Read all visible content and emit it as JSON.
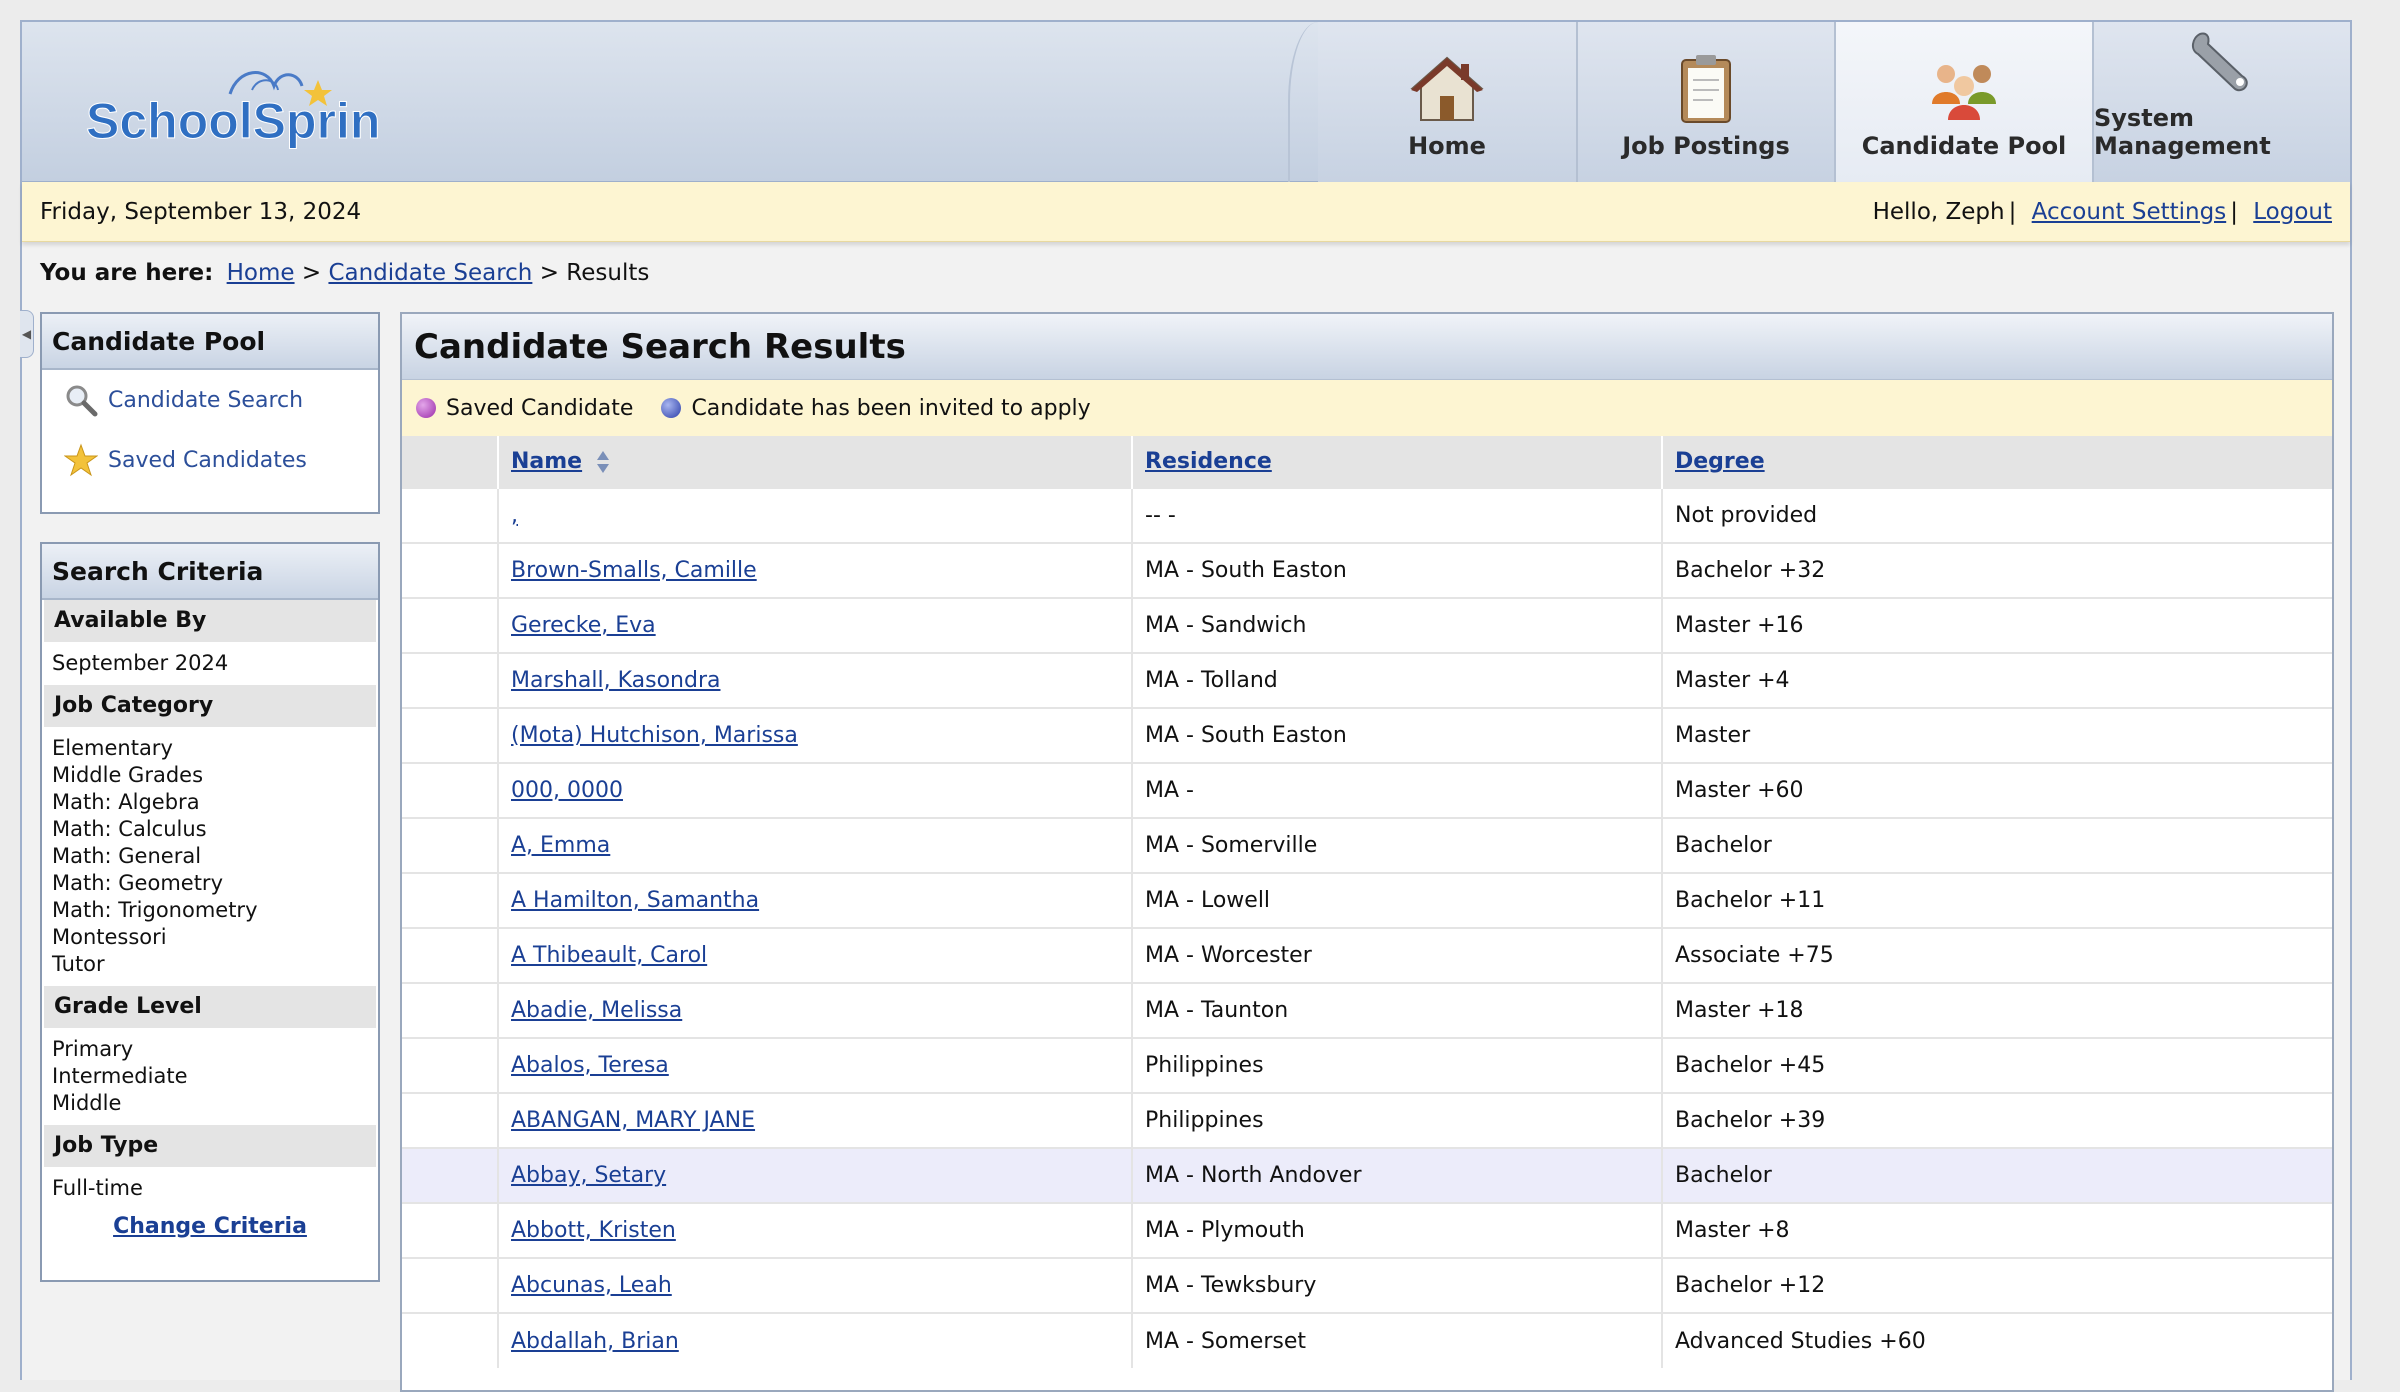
{
  "brand": {
    "logo_text": "SchoolSpring"
  },
  "nav": [
    {
      "label": "Home",
      "icon": "house-icon",
      "active": false
    },
    {
      "label": "Job Postings",
      "icon": "clipboard-icon",
      "active": false
    },
    {
      "label": "Candidate Pool",
      "icon": "people-icon",
      "active": true
    },
    {
      "label": "System Management",
      "icon": "wrench-icon",
      "active": false
    }
  ],
  "datebar": {
    "date": "Friday, September 13, 2024",
    "greeting": "Hello, Zeph",
    "account_settings": "Account Settings",
    "logout": "Logout"
  },
  "breadcrumb": {
    "prefix": "You are here:",
    "home": "Home",
    "candidate_search": "Candidate Search",
    "current": "Results"
  },
  "pool_panel": {
    "title": "Candidate Pool",
    "candidate_search": "Candidate Search",
    "saved_candidates": "Saved Candidates"
  },
  "criteria": {
    "title": "Search Criteria",
    "available_by_label": "Available By",
    "available_by_value": [
      "September 2024"
    ],
    "job_category_label": "Job Category",
    "job_category_values": [
      "Elementary",
      "Middle Grades",
      "Math: Algebra",
      "Math: Calculus",
      "Math: General",
      "Math: Geometry",
      "Math: Trigonometry",
      "Montessori",
      "Tutor"
    ],
    "grade_level_label": "Grade Level",
    "grade_level_values": [
      "Primary",
      "Intermediate",
      "Middle"
    ],
    "job_type_label": "Job Type",
    "job_type_values": [
      "Full-time"
    ],
    "change_link": "Change Criteria"
  },
  "results": {
    "title": "Candidate Search Results",
    "legend_saved": "Saved Candidate",
    "legend_invited": "Candidate has been invited to apply",
    "columns": {
      "name": "Name",
      "residence": "Residence",
      "degree": "Degree"
    },
    "rows": [
      {
        "name": ",",
        "residence": "-- -",
        "degree": "Not provided"
      },
      {
        "name": "Brown-Smalls, Camille",
        "residence": "MA - South Easton",
        "degree": "Bachelor +32"
      },
      {
        "name": "Gerecke, Eva",
        "residence": "MA - Sandwich",
        "degree": "Master +16"
      },
      {
        "name": "Marshall, Kasondra",
        "residence": "MA - Tolland",
        "degree": "Master +4"
      },
      {
        "name": "(Mota) Hutchison, Marissa",
        "residence": "MA - South Easton",
        "degree": "Master"
      },
      {
        "name": "000, 0000",
        "residence": "MA -",
        "degree": "Master +60"
      },
      {
        "name": "A, Emma",
        "residence": "MA - Somerville",
        "degree": "Bachelor"
      },
      {
        "name": "A Hamilton, Samantha",
        "residence": "MA - Lowell",
        "degree": "Bachelor +11"
      },
      {
        "name": "A Thibeault, Carol",
        "residence": "MA - Worcester",
        "degree": "Associate +75"
      },
      {
        "name": "Abadie, Melissa",
        "residence": "MA - Taunton",
        "degree": "Master +18"
      },
      {
        "name": "Abalos, Teresa",
        "residence": "Philippines",
        "degree": "Bachelor +45"
      },
      {
        "name": "ABANGAN, MARY JANE",
        "residence": "Philippines",
        "degree": "Bachelor +39"
      },
      {
        "name": "Abbay, Setary",
        "residence": "MA - North Andover",
        "degree": "Bachelor",
        "highlighted": true
      },
      {
        "name": "Abbott, Kristen",
        "residence": "MA - Plymouth",
        "degree": "Master +8"
      },
      {
        "name": "Abcunas, Leah",
        "residence": "MA - Tewksbury",
        "degree": "Bachelor +12"
      },
      {
        "name": "Abdallah, Brian",
        "residence": "MA - Somerset",
        "degree": "Advanced Studies +60"
      }
    ]
  }
}
